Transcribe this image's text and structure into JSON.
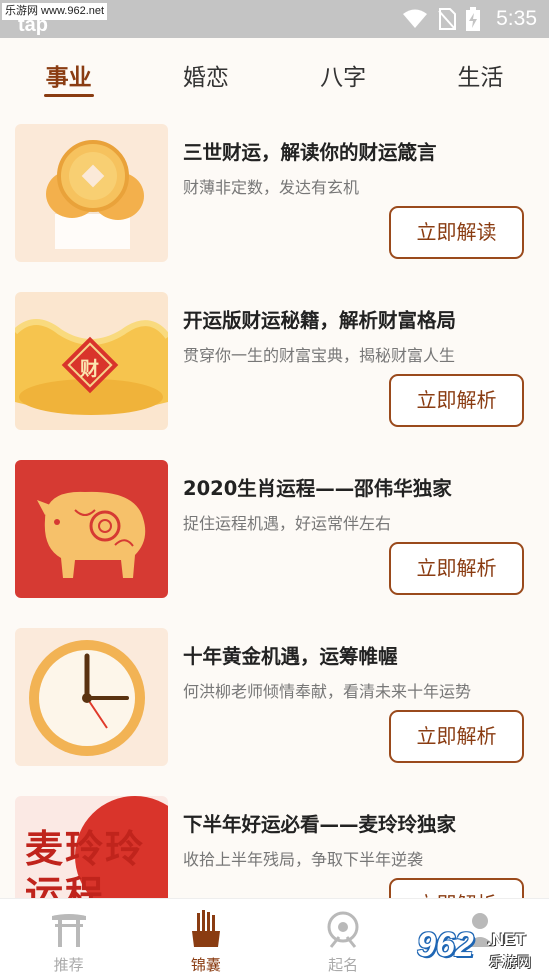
{
  "status_bar": {
    "watermark_site": "乐游网 www.962.net",
    "app_mark": "tap",
    "time": "5:35"
  },
  "tabs": [
    {
      "label": "事业",
      "active": true
    },
    {
      "label": "婚恋",
      "active": false
    },
    {
      "label": "八字",
      "active": false
    },
    {
      "label": "生活",
      "active": false
    }
  ],
  "cards": [
    {
      "title": "三世财运，解读你的财运箴言",
      "subtitle": "财薄非定数，发达有玄机",
      "button": "立即解读",
      "thumb_icon": "gold-coins-icon"
    },
    {
      "title": "开运版财运秘籍，解析财富格局",
      "subtitle": "贯穿你一生的财富宝典，揭秘财富人生",
      "button": "立即解析",
      "thumb_icon": "gold-ingot-icon",
      "thumb_text": "财"
    },
    {
      "title": "2020生肖运程——邵伟华独家",
      "subtitle": "捉住运程机遇，好运常伴左右",
      "button": "立即解析",
      "thumb_icon": "golden-pig-icon"
    },
    {
      "title": "十年黄金机遇，运筹帷幄",
      "subtitle": "何洪柳老师倾情奉献，看清未来十年运势",
      "button": "立即解析",
      "thumb_icon": "clock-icon"
    },
    {
      "title": "下半年好运必看——麦玲玲独家",
      "subtitle": "收拾上半年残局，争取下半年逆袭",
      "button": "立即解析",
      "thumb_icon": "fortune-calligraphy-icon",
      "thumb_text": "麦玲玲运程"
    }
  ],
  "bottom_nav": [
    {
      "label": "推荐",
      "icon": "torii-gate-icon",
      "active": false
    },
    {
      "label": "锦囊",
      "icon": "bamboo-sticks-icon",
      "active": true
    },
    {
      "label": "起名",
      "icon": "compass-icon",
      "active": false
    },
    {
      "label": "",
      "icon": "user-icon",
      "active": false
    }
  ],
  "watermark": {
    "brand": "962",
    "net": ".NET",
    "sub": "乐游网"
  }
}
